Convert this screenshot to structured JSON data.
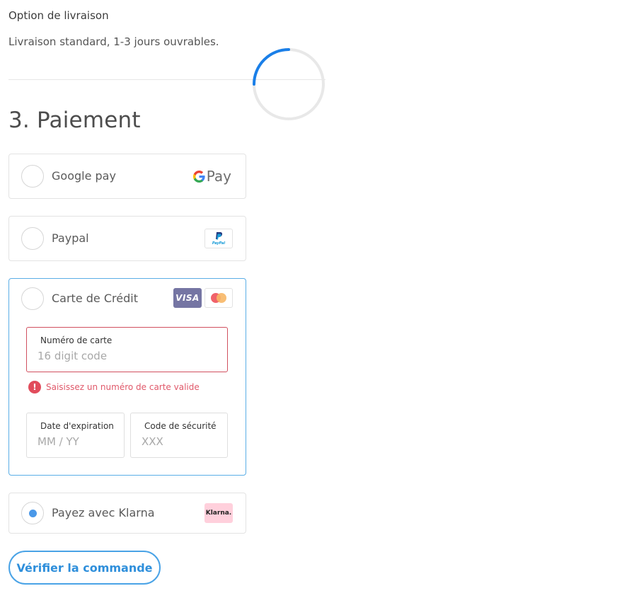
{
  "shipping": {
    "title": "Option de livraison",
    "description": "Livraison standard, 1-3 jours ouvrables."
  },
  "payment": {
    "section_title": "3. Paiement",
    "methods": [
      {
        "label": "Google pay",
        "logo_text": "Pay",
        "selected": false
      },
      {
        "label": "Paypal",
        "logo_text": "PayPal",
        "selected": false
      },
      {
        "label": "Carte de Crédit",
        "logo_text": "VISA",
        "selected": false
      },
      {
        "label": "Payez avec Klarna",
        "logo_text": "Klarna.",
        "selected": true
      }
    ],
    "card_form": {
      "number_label": "Numéro de carte",
      "number_placeholder": "16 digit code",
      "number_error": "Saisissez un numéro de carte valide",
      "expiry_label": "Date d'expiration",
      "expiry_placeholder": "MM / YY",
      "cvc_label": "Code de sécurité",
      "cvc_placeholder": "XXX"
    }
  },
  "actions": {
    "submit_label": "Vérifier la commande"
  },
  "colors": {
    "accent": "#4aa3e6",
    "error": "#e14c5c",
    "spinner": "#1a7fe8",
    "visa_bg": "#7575a3",
    "klarna_bg": "#ffd0dc"
  }
}
